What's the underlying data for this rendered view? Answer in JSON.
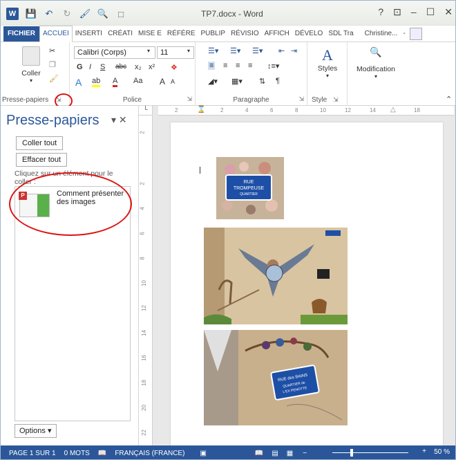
{
  "window": {
    "title": "TP7.docx - Word",
    "controls": [
      "?",
      "⊡",
      "–",
      "☐",
      "✕"
    ]
  },
  "tabs": [
    {
      "label": "FICHIER",
      "type": "file"
    },
    {
      "label": "ACCUEI",
      "type": "active"
    },
    {
      "label": "INSERTI"
    },
    {
      "label": "CRÉATI"
    },
    {
      "label": "MISE E"
    },
    {
      "label": "RÉFÉRE"
    },
    {
      "label": "PUBLIP"
    },
    {
      "label": "RÉVISIO"
    },
    {
      "label": "AFFICH"
    },
    {
      "label": "DÉVELO"
    },
    {
      "label": "SDL Tra"
    }
  ],
  "user": {
    "name": "Christine..."
  },
  "ribbon": {
    "clipboard": {
      "paste_label": "Coller",
      "group_label": "Presse-papiers"
    },
    "font": {
      "font_name": "Calibri (Corps)",
      "font_size": "11",
      "group_label": "Police",
      "bold": "G",
      "italic": "I",
      "underline": "S",
      "strike": "abc",
      "sub": "x₂",
      "sup": "x²",
      "case": "Aa",
      "grow": "A",
      "shrink": "A"
    },
    "paragraph": {
      "group_label": "Paragraphe"
    },
    "styles": {
      "label": "Styles",
      "group_label": "Style"
    },
    "editing": {
      "label": "Modification"
    }
  },
  "pane": {
    "title": "Presse-papiers",
    "paste_all": "Coller tout",
    "clear_all": "Effacer tout",
    "hint": "Cliquez sur un élément pour le coller :",
    "items": [
      {
        "text": "Comment présenter des images"
      }
    ],
    "options": "Options ▾"
  },
  "ruler": {
    "h_ticks": [
      "2",
      "1",
      "2",
      "4",
      "6",
      "8",
      "10",
      "12",
      "14",
      "18"
    ],
    "v_ticks": [
      "2",
      "2",
      "4",
      "6",
      "8",
      "10",
      "12",
      "14",
      "16",
      "18",
      "20",
      "22"
    ]
  },
  "document": {
    "images": [
      {
        "name": "rue-trompeuse-sign",
        "sign_text": "RUE TROMPEUSE QUARTIER DE L'EX PENOTTE"
      },
      {
        "name": "mural-bird-monkeys"
      },
      {
        "name": "rue-des-bains-sign",
        "sign_text": "RUE des BAINS QUARTIER de L'EX PENOTTE"
      }
    ]
  },
  "status": {
    "page": "PAGE 1 SUR 1",
    "words": "0 MOTS",
    "language": "FRANÇAIS (FRANCE)",
    "zoom": "50 %"
  },
  "colors": {
    "accent": "#2b579a",
    "annotation": "#d11111"
  }
}
